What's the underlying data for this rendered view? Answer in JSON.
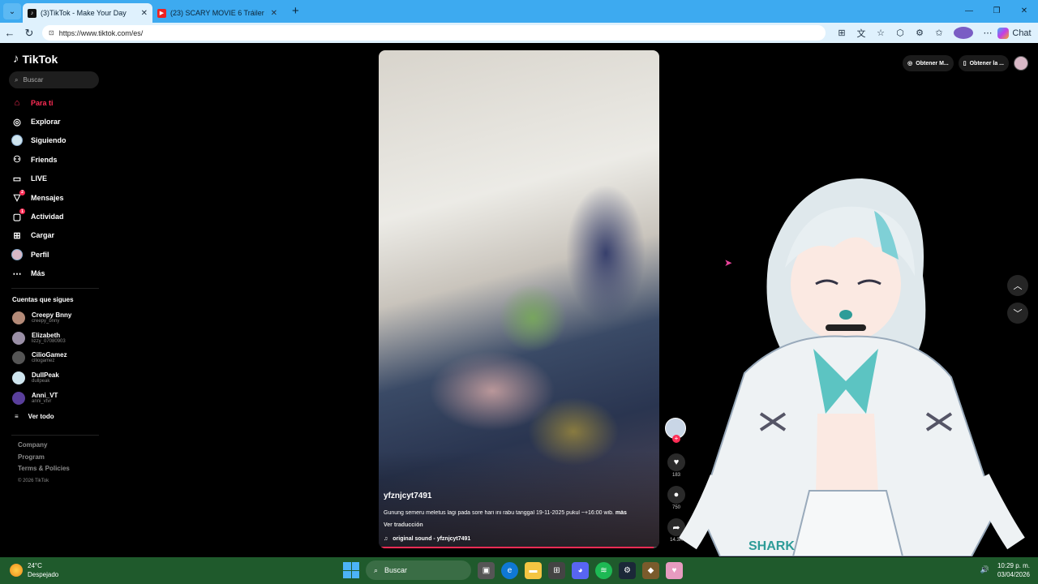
{
  "browser": {
    "tabs": [
      {
        "title": "(3)TikTok - Make Your Day",
        "active": true,
        "favicon": "tiktok-icon"
      },
      {
        "title": "(23) SCARY MOVIE 6 Tráiler Español",
        "active": false,
        "favicon": "youtube-icon"
      }
    ],
    "url": "https://www.tiktok.com/es/",
    "chat_label": "Chat"
  },
  "sidebar": {
    "logo": "TikTok",
    "search_placeholder": "Buscar",
    "nav": [
      {
        "label": "Para ti",
        "icon": "home-icon",
        "active": true
      },
      {
        "label": "Explorar",
        "icon": "compass-icon"
      },
      {
        "label": "Siguiendo",
        "icon": "avatar-icon"
      },
      {
        "label": "Friends",
        "icon": "friends-icon"
      },
      {
        "label": "LIVE",
        "icon": "live-icon"
      },
      {
        "label": "Mensajes",
        "icon": "messages-icon",
        "badge": "2"
      },
      {
        "label": "Actividad",
        "icon": "activity-icon",
        "badge": "1"
      },
      {
        "label": "Cargar",
        "icon": "upload-icon"
      },
      {
        "label": "Perfil",
        "icon": "profile-icon"
      },
      {
        "label": "Más",
        "icon": "more-icon"
      }
    ],
    "following_title": "Cuentas que sigues",
    "following": [
      {
        "name": "Creepy Bnny",
        "handle": "creepy_bnny",
        "color": "#b48a78"
      },
      {
        "name": "Elizabeth",
        "handle": "lizzy_07080903",
        "color": "#9a8fa6"
      },
      {
        "name": "CilioGamez",
        "handle": "ciliogamez",
        "color": "#555555"
      },
      {
        "name": "DullPeak",
        "handle": "dullpeak",
        "color": "#cfe5ef"
      },
      {
        "name": "Anni_VT",
        "handle": "anni_vtvr",
        "color": "#5a3f9c"
      }
    ],
    "see_all": "Ver todo",
    "footer": [
      "Company",
      "Program",
      "Terms & Policies"
    ],
    "copyright": "© 2026 TikTok"
  },
  "video": {
    "username": "yfznjcyt7491",
    "caption": "Gunung semeru meletus lagi pada sore hari ini rabu tanggal 19-11-2025 pukul ~+16:00 wib.",
    "more": "más",
    "translate": "Ver traducción",
    "sound": "original sound - yfznjcyt7491",
    "progress": 0.98
  },
  "actions": {
    "likes": "183",
    "comments": "750",
    "shares": "14.3K"
  },
  "topbar": {
    "get_coins": "Obtener M...",
    "get_app": "Obtener la ..."
  },
  "taskbar": {
    "temperature": "24°C",
    "weather": "Despejado",
    "weather_badge": "1",
    "search_label": "Buscar",
    "time": "10:29 p. m.",
    "date": "03/04/2026"
  }
}
